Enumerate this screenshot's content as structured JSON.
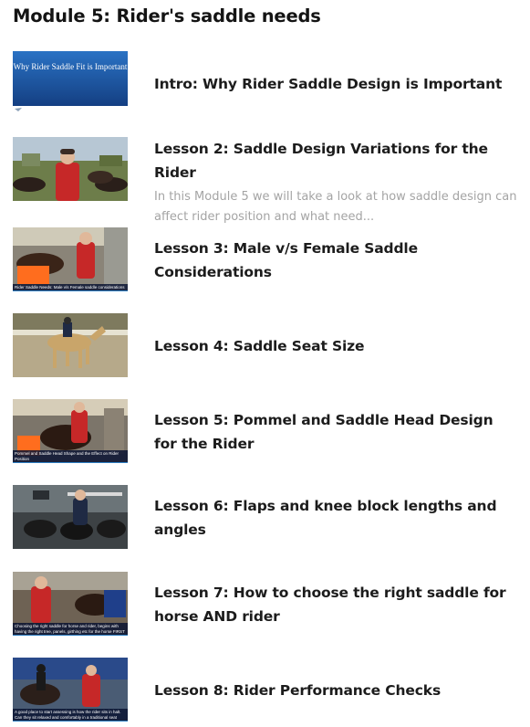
{
  "module": {
    "title": "Module 5: Rider's saddle needs"
  },
  "lessons": [
    {
      "title": "Intro: Why Rider Saddle Design is Important",
      "description": "",
      "thumbnail_text": "Why Rider Saddle Fit is Important",
      "thumbnail_caption": ""
    },
    {
      "title": "Lesson 2: Saddle Design Variations for the Rider",
      "description": "In this Module 5 we will take a look at how saddle design can affect rider position and what need...",
      "thumbnail_caption": ""
    },
    {
      "title": "Lesson 3: Male v/s Female Saddle Considerations",
      "description": "",
      "thumbnail_caption": "Rider Saddle Needs: Male v/s Female saddle considerations"
    },
    {
      "title": "Lesson 4: Saddle Seat Size",
      "description": "",
      "thumbnail_caption": ""
    },
    {
      "title": "Lesson 5: Pommel and Saddle Head Design for the Rider",
      "description": "",
      "thumbnail_caption": "Pommel and Saddle Head Shape and the Effect on Rider Position"
    },
    {
      "title": "Lesson 6: Flaps and knee block lengths and angles",
      "description": "",
      "thumbnail_caption": ""
    },
    {
      "title": "Lesson 7: How to choose the right saddle for horse AND rider",
      "description": "",
      "thumbnail_caption": "Choosing the right saddle for horse and rider, begins with having the right tree, panels, girthing etc for the horse FIRST"
    },
    {
      "title": "Lesson 8: Rider Performance Checks",
      "description": "",
      "thumbnail_caption": "A good place to start assessing is how the rider sits in halt. Can they sit relaxed and comfortably in a traditional seat"
    }
  ],
  "colors": {
    "title": "#141414",
    "description": "#a4a4a4",
    "caption_bar": "#0a1432",
    "caption_accent": "#2d7ec2",
    "intro_blue": "#1f5fae"
  },
  "icons": {
    "thumbnails": [
      "slide-thumbnail",
      "video-thumbnail"
    ]
  }
}
